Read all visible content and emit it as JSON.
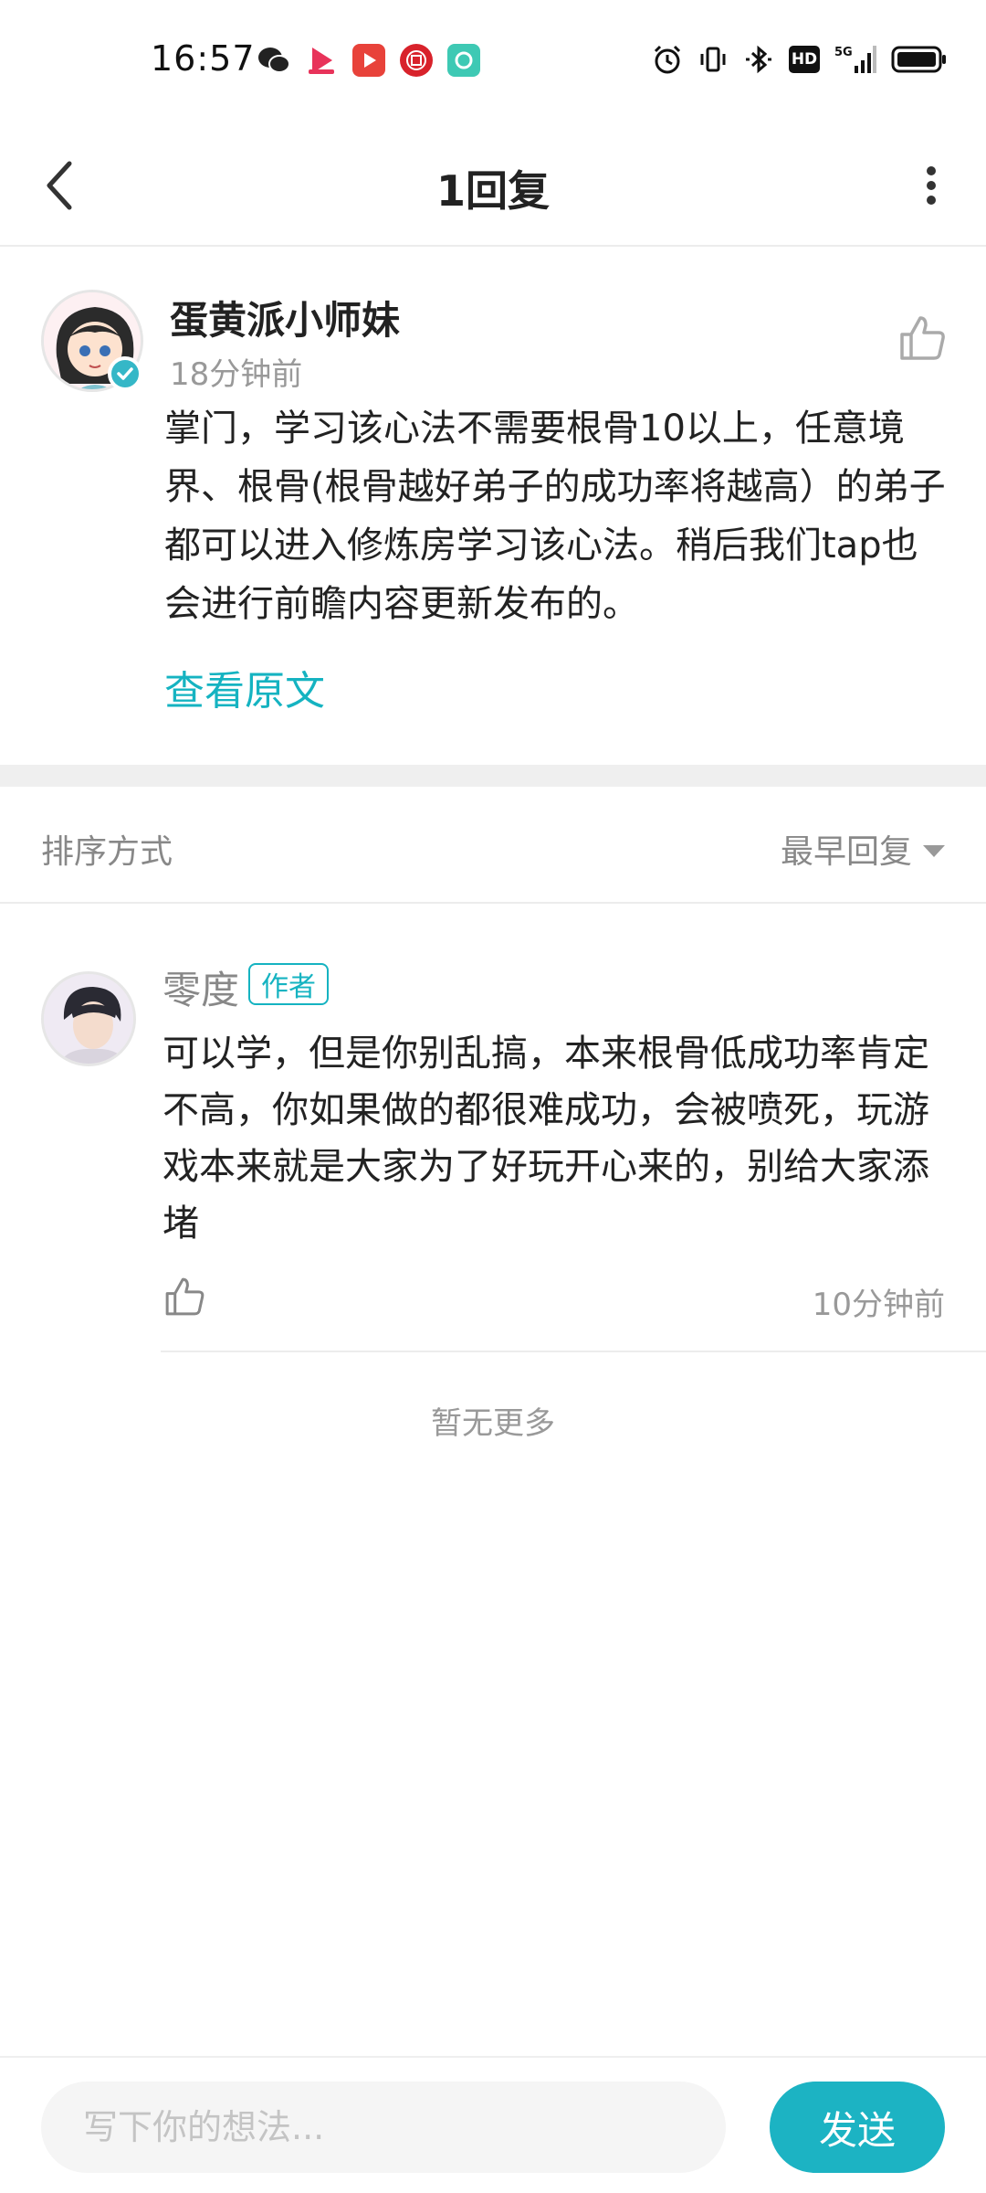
{
  "status_bar": {
    "time": "16:57",
    "notification_icons": [
      "wechat-icon",
      "video-app-icon",
      "play-app-icon",
      "bank-app-icon",
      "chat-app-icon"
    ],
    "system_icons": [
      "alarm-icon",
      "vibrate-icon",
      "bluetooth-icon",
      "hd-icon",
      "5g-signal-icon",
      "battery-icon"
    ],
    "hd_label": "HD",
    "network_label": "5G"
  },
  "header": {
    "title": "1回复"
  },
  "post": {
    "author": "蛋黄派小师妹",
    "time": "18分钟前",
    "content": "掌门，学习该心法不需要根骨10以上，任意境界、根骨(根骨越好弟子的成功率将越高）的弟子都可以进入修炼房学习该心法。稍后我们tap也会进行前瞻内容更新发布的。",
    "view_original": "查看原文"
  },
  "sort": {
    "label": "排序方式",
    "selected": "最早回复"
  },
  "reply": {
    "author": "零度",
    "badge": "作者",
    "content": "可以学，但是你别乱搞，本来根骨低成功率肯定不高，你如果做的都很难成功，会被喷死，玩游戏本来就是大家为了好玩开心来的，别给大家添堵",
    "time": "10分钟前"
  },
  "no_more": "暂无更多",
  "composer": {
    "placeholder": "写下你的想法...",
    "send_label": "发送"
  },
  "colors": {
    "accent": "#15b3c1",
    "send_button": "#1cb3c3",
    "divider": "#efefef"
  }
}
